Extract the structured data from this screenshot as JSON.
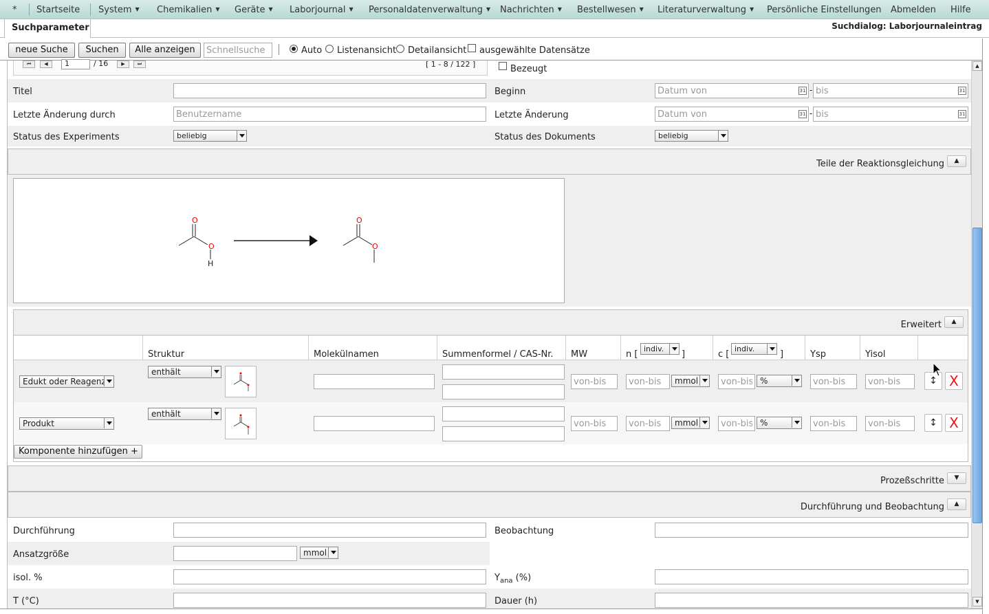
{
  "menu": {
    "star": "*",
    "items": [
      {
        "label": "Startseite",
        "dropdown": false
      },
      {
        "label": "System",
        "dropdown": true
      },
      {
        "label": "Chemikalien",
        "dropdown": true
      },
      {
        "label": "Geräte",
        "dropdown": true
      },
      {
        "label": "Laborjournal",
        "dropdown": true
      },
      {
        "label": "Personaldatenverwaltung",
        "dropdown": true
      },
      {
        "label": "Nachrichten",
        "dropdown": true
      },
      {
        "label": "Bestellwesen",
        "dropdown": true
      },
      {
        "label": "Literaturverwaltung",
        "dropdown": true
      },
      {
        "label": "Persönliche Einstellungen",
        "dropdown": false
      },
      {
        "label": "Abmelden",
        "dropdown": false
      },
      {
        "label": "Hilfe",
        "dropdown": false
      }
    ]
  },
  "tab": {
    "label": "Suchparameter"
  },
  "dialog_title": "Suchdialog: Laborjournaleintrag",
  "toolbar": {
    "new_search": "neue Suche",
    "search": "Suchen",
    "show_all": "Alle anzeigen",
    "quick_search_placeholder": "Schnellsuche",
    "view_auto": "Auto",
    "view_list": "Listenansicht",
    "view_detail": "Detailansicht",
    "selected_records": "ausgewählte Datensätze"
  },
  "pager": {
    "page": "1",
    "of": "/ 16",
    "range": "[ 1 - 8 / 122 ]"
  },
  "form": {
    "witnessed": "Bezeugt",
    "title_label": "Titel",
    "begin_label": "Beginn",
    "date_from": "Datum von",
    "date_to": "bis",
    "last_changed_by_label": "Letzte Änderung durch",
    "username_placeholder": "Benutzername",
    "last_change_label": "Letzte Änderung",
    "exp_status_label": "Status des Experiments",
    "doc_status_label": "Status des Dokuments",
    "any": "beliebig"
  },
  "sections": {
    "reaction": "Teile der Reaktionsgleichung",
    "advanced": "Erweitert",
    "process_steps": "Prozeßschritte",
    "execution": "Durchführung und Beobachtung"
  },
  "reaction": {
    "atom_o": "O",
    "atom_h": "H"
  },
  "table": {
    "col_structure": "Struktur",
    "col_names": "Molekülnamen",
    "col_formula": "Summenformel / CAS-Nr.",
    "col_mw": "MW",
    "col_n_prefix": "n [",
    "col_c_prefix": "c [",
    "col_bracket_close": "]",
    "indiv": "indiv.",
    "col_ysp": "Ysp",
    "col_yisol": "Yisol",
    "range_placeholder": "von-bis",
    "contains": "enthält",
    "unit_mmol": "mmol",
    "unit_percent": "%",
    "rows": [
      {
        "role": "Edukt oder Reagenz"
      },
      {
        "role": "Produkt"
      }
    ],
    "add_component": "Komponente hinzufügen +",
    "delete": "X",
    "move": "↕"
  },
  "execution": {
    "execution_label": "Durchführung",
    "observation_label": "Beobachtung",
    "batch_size_label": "Ansatzgröße",
    "batch_unit": "mmol",
    "isol_label": "isol. %",
    "yana_label": "Y",
    "yana_sub": "ana",
    "yana_suffix": " (%)",
    "temp_label": "T (°C)",
    "duration_label": "Dauer (h)"
  }
}
